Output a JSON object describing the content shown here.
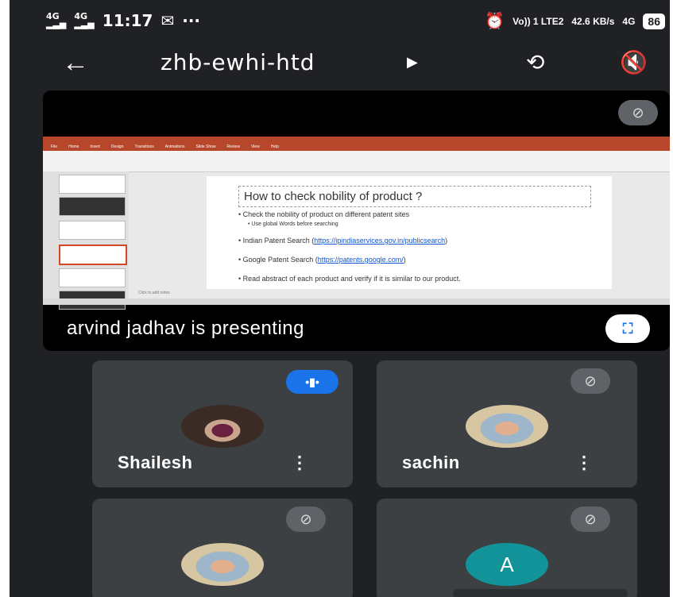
{
  "status": {
    "net1": "4G",
    "net2": "4G",
    "time": "11:17",
    "mail_icon": "✉",
    "more": "···",
    "volte": "Vo)) 1 LTE2",
    "speed": "42.6 KB/s",
    "net_right": "4G",
    "battery": "86"
  },
  "app": {
    "meeting_code": "zhb-ewhi-htd"
  },
  "presentation": {
    "label": "arvind jadhav is presenting",
    "slide": {
      "title": "How to check nobility of product ?",
      "bullet1": "Check the nobility of product on different patent sites",
      "bullet1_sub": "Use global Words before searching",
      "bullet2_prefix": "Indian Patent Search (",
      "bullet2_link": "https://ipindiaservices.gov.in/publicsearch",
      "bullet2_suffix": ")",
      "bullet3_prefix": "Google Patent Search (",
      "bullet3_link": "https://patents.google.com/",
      "bullet3_suffix": ")",
      "bullet4": "Read abstract of each product and verify if it is similar to our product."
    },
    "notes_placeholder": "Click to add notes",
    "ppt_tabs": [
      "File",
      "Home",
      "Insert",
      "Design",
      "Transitions",
      "Animations",
      "Slide Show",
      "Review",
      "View",
      "Help"
    ]
  },
  "participants": [
    {
      "name": "Shailesh"
    },
    {
      "name": "sachin"
    },
    {
      "name": ""
    },
    {
      "name": "",
      "initial": "A"
    }
  ],
  "icons": {
    "mic_off": "mic-off-icon",
    "speaking": "audio-wave-icon",
    "fullscreen": "fullscreen-icon",
    "more_vert": "more-vert-icon"
  }
}
